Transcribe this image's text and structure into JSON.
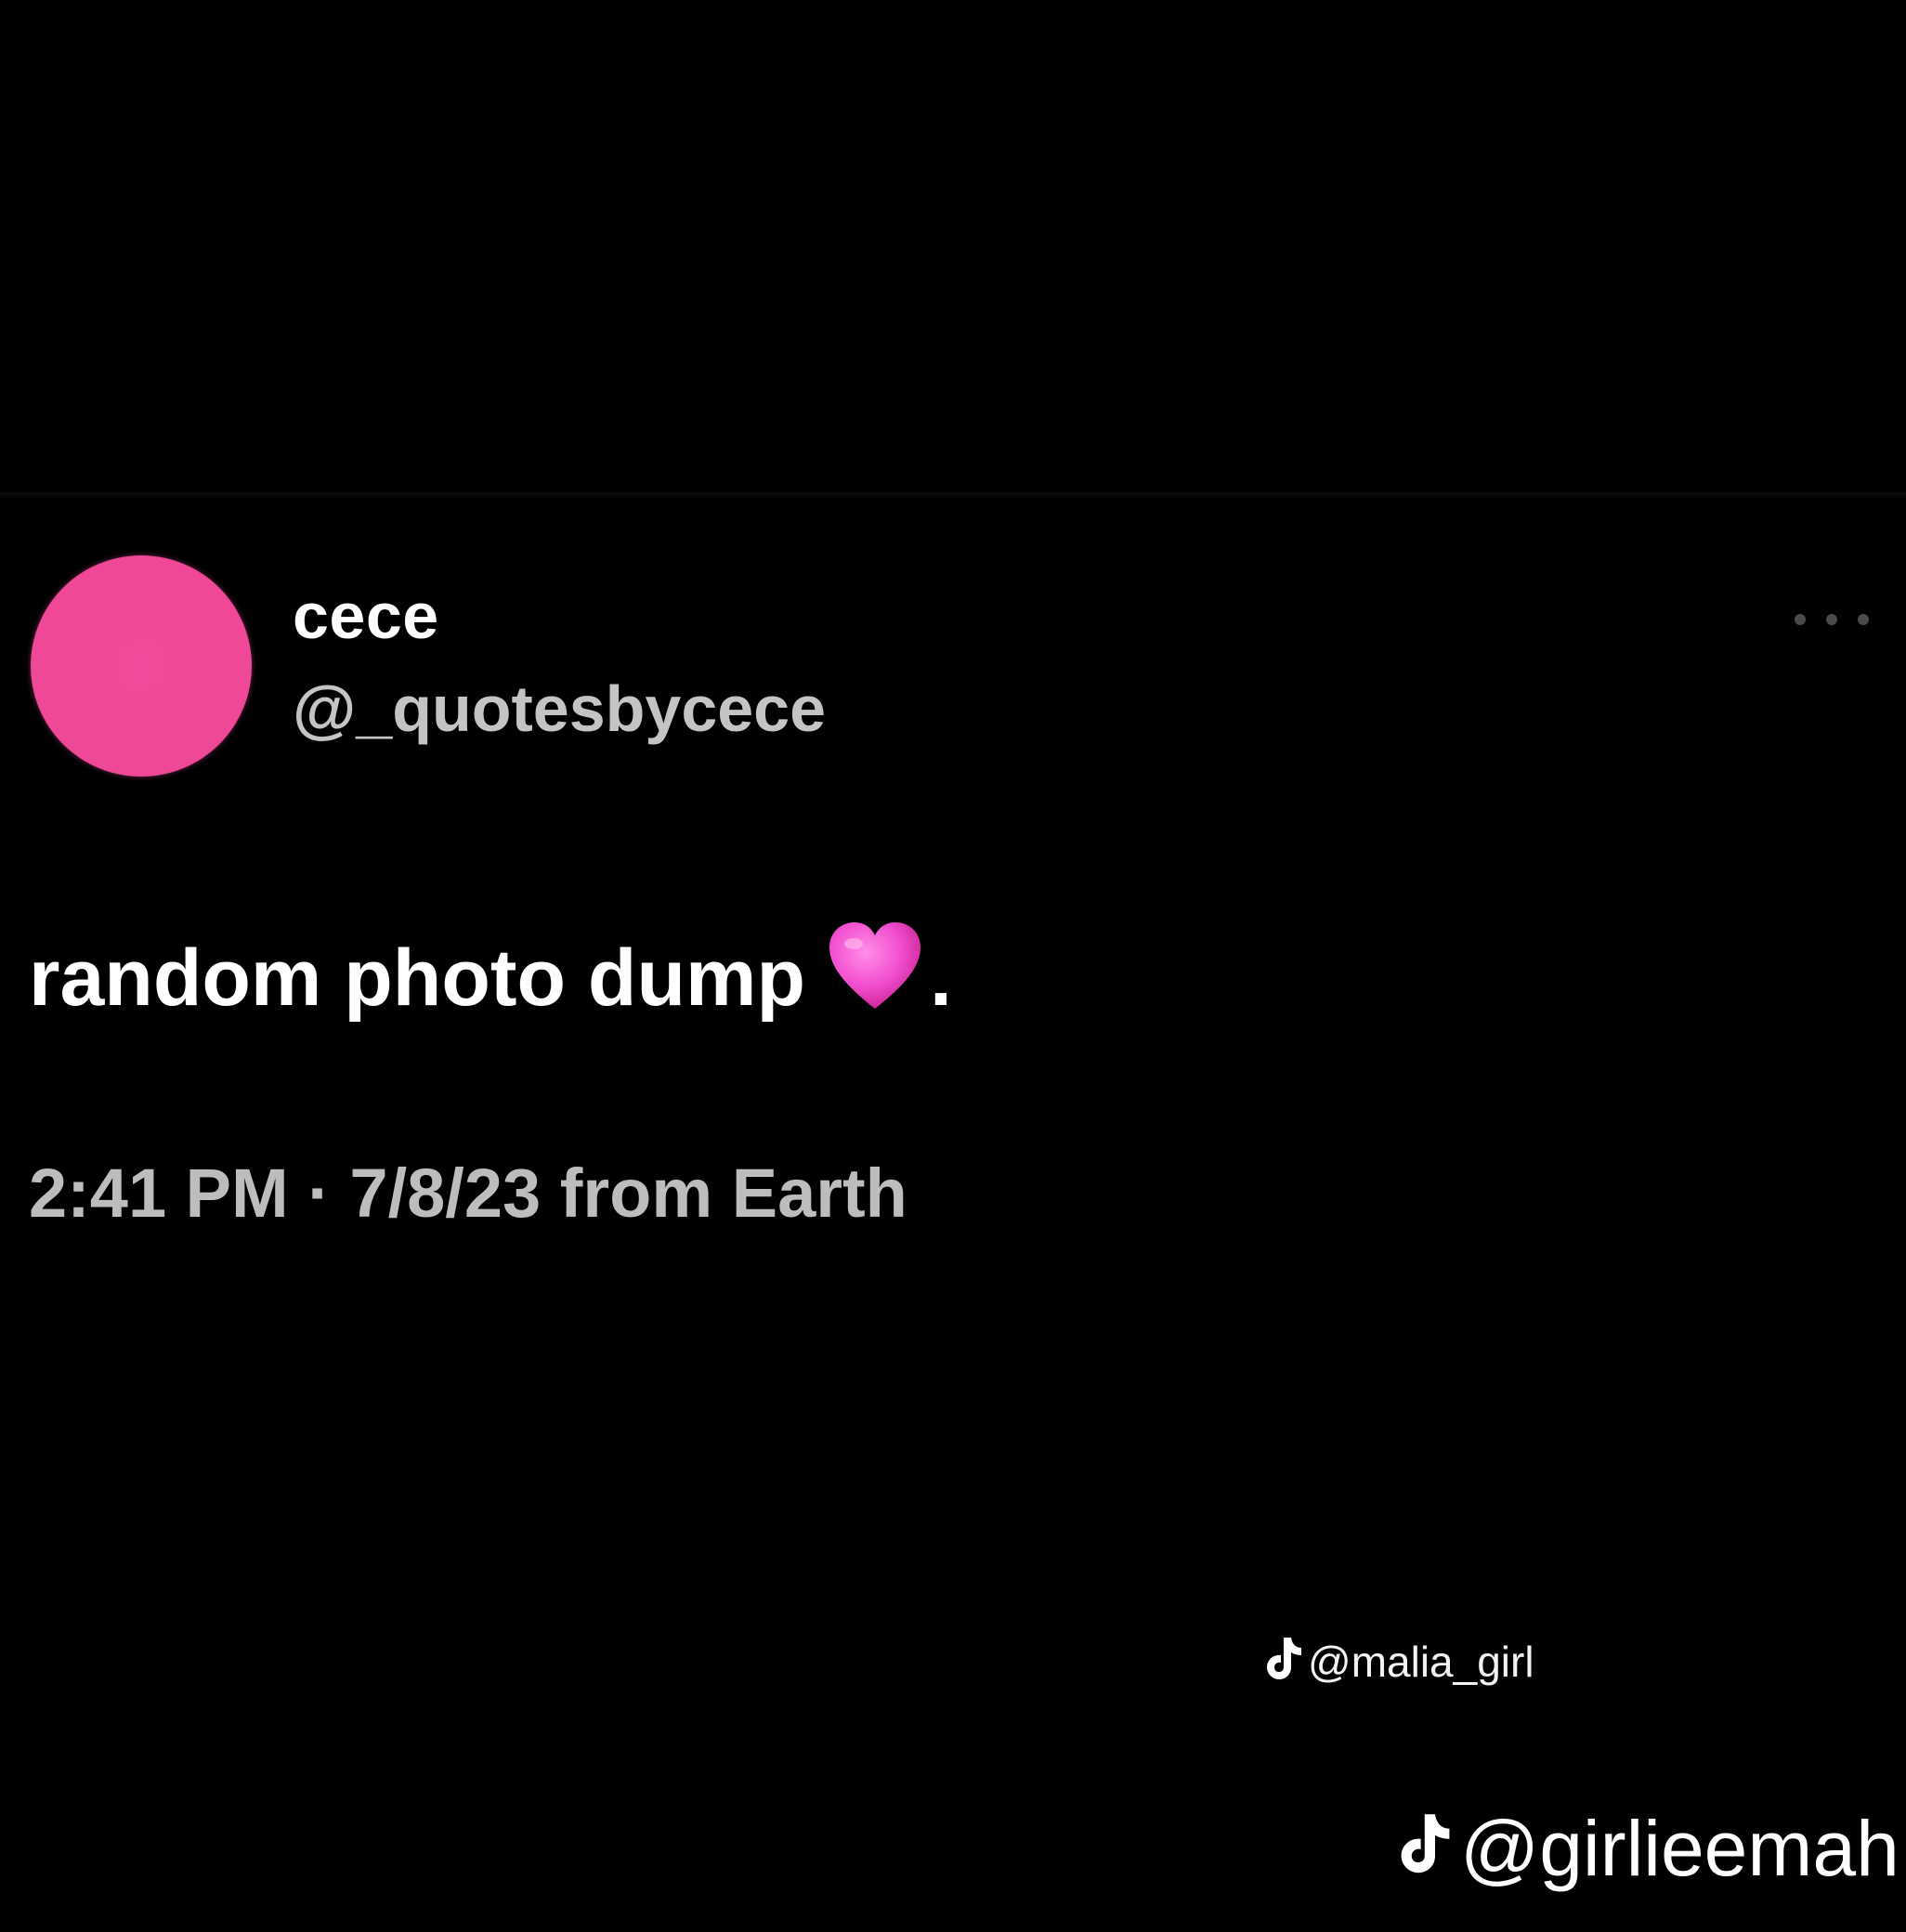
{
  "post": {
    "display_name": "cece",
    "handle": "@_quotesbycece",
    "text": "random photo dump",
    "text_emoji": "pink-heart-icon",
    "text_suffix": ".",
    "timestamp": "2:41 PM · 7/8/23 from Earth",
    "avatar_color": "#ee4896"
  },
  "watermarks": {
    "small_handle": "@malia_girl",
    "large_handle": "@girlieemah",
    "icon": "tiktok-icon"
  },
  "colors": {
    "background": "#000000",
    "primary_text": "#ffffff",
    "secondary_text": "#c4c4c4",
    "heart": "#f24fd0"
  }
}
